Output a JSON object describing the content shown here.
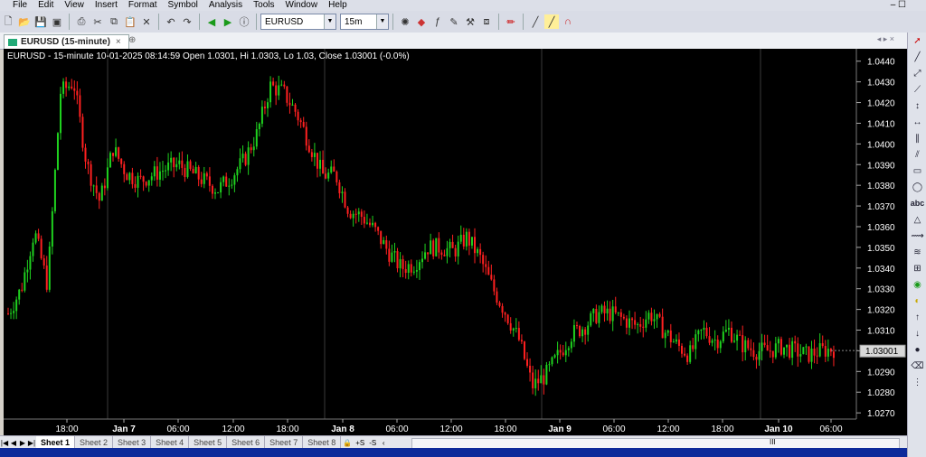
{
  "menu": [
    "File",
    "Edit",
    "View",
    "Insert",
    "Format",
    "Symbol",
    "Analysis",
    "Tools",
    "Window",
    "Help"
  ],
  "window_controls": "–  ☐",
  "toolbar": {
    "symbol": "EURUSD",
    "interval": "15m"
  },
  "tab": {
    "title": "EURUSD (15-minute)"
  },
  "chart": {
    "info": "EURUSD - 15-minute 10-01-2025 08:14:59 Open 1.0301, Hi 1.0303, Lo 1.03, Close 1.03001 (-0.0%)",
    "last_price_label": "1.03001"
  },
  "sheets": [
    "Sheet 1",
    "Sheet 2",
    "Sheet 3",
    "Sheet 4",
    "Sheet 5",
    "Sheet 6",
    "Sheet 7",
    "Sheet 8"
  ],
  "scroll_label": "III",
  "colors": {
    "up": "#1fd21f",
    "down": "#ff2020",
    "bg": "#000000",
    "grid": "#3a3a3a",
    "axis_text": "#ffffff"
  },
  "chart_data": {
    "type": "candlestick",
    "symbol": "EURUSD",
    "interval": "15-minute",
    "y_ticks": [
      "1.0270",
      "1.0280",
      "1.0290",
      "1.0300",
      "1.0310",
      "1.0320",
      "1.0330",
      "1.0340",
      "1.0350",
      "1.0360",
      "1.0370",
      "1.0380",
      "1.0390",
      "1.0400",
      "1.0410",
      "1.0420",
      "1.0430",
      "1.0440"
    ],
    "x_ticks": [
      "18:00",
      "Jan 7",
      "06:00",
      "12:00",
      "18:00",
      "Jan 8",
      "06:00",
      "12:00",
      "18:00",
      "Jan 9",
      "06:00",
      "12:00",
      "18:00",
      "Jan 10",
      "06:00"
    ],
    "ylim": [
      1.0267,
      1.0446
    ],
    "day_separators": [
      "Jan 7",
      "Jan 8",
      "Jan 9",
      "Jan 10"
    ],
    "last_close": 1.03001,
    "close_path": [
      1.0318,
      1.033,
      1.0358,
      1.0332,
      1.0425,
      1.043,
      1.039,
      1.0372,
      1.0398,
      1.0386,
      1.0382,
      1.0385,
      1.0388,
      1.039,
      1.0386,
      1.0382,
      1.0378,
      1.0384,
      1.0392,
      1.0405,
      1.0428,
      1.0425,
      1.0415,
      1.04,
      1.0385,
      1.0385,
      1.0368,
      1.0365,
      1.0358,
      1.0348,
      1.034,
      1.0342,
      1.035,
      1.035,
      1.0348,
      1.0355,
      1.0345,
      1.033,
      1.0318,
      1.0305,
      1.0283,
      1.0288,
      1.0298,
      1.0308,
      1.0312,
      1.0318,
      1.0318,
      1.0315,
      1.0312,
      1.0318,
      1.031,
      1.0303,
      1.0298,
      1.031,
      1.0305,
      1.031,
      1.0303,
      1.03,
      1.03,
      1.0302,
      1.03,
      1.0298,
      1.03,
      1.0301
    ]
  }
}
